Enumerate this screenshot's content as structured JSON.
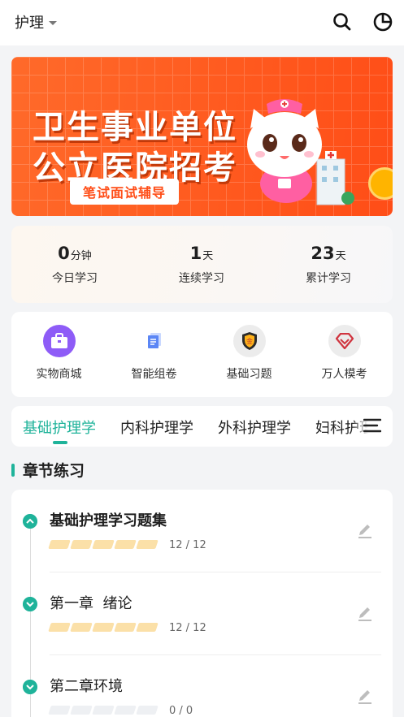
{
  "header": {
    "subject": "护理"
  },
  "banner": {
    "title_line1": "卫生事业单位",
    "title_line2": "公立医院招考",
    "tag": "笔试面试辅导"
  },
  "stats": [
    {
      "value": "0",
      "unit": "分钟",
      "label": "今日学习"
    },
    {
      "value": "1",
      "unit": "天",
      "label": "连续学习"
    },
    {
      "value": "23",
      "unit": "天",
      "label": "累计学习"
    }
  ],
  "quick_actions": [
    {
      "label": "实物商城",
      "icon": "shop-bag-icon"
    },
    {
      "label": "智能组卷",
      "icon": "paper-stack-icon"
    },
    {
      "label": "基础习题",
      "icon": "gold-shield-icon"
    },
    {
      "label": "万人模考",
      "icon": "diamond-icon"
    }
  ],
  "tabs": [
    "基础护理学",
    "内科护理学",
    "外科护理学",
    "妇科护理学"
  ],
  "section": {
    "title": "章节练习"
  },
  "chapters": [
    {
      "title": "基础护理学习题集",
      "count": "12 / 12",
      "progress": 1.0
    },
    {
      "title": "第一章  绪论",
      "count": "12 / 12",
      "progress": 1.0
    },
    {
      "title": "第二章环境",
      "count": "0 / 0",
      "progress": 0.0
    }
  ],
  "colors": {
    "accent": "#1fb39a",
    "banner": "#ff5a1f",
    "progress_fill": "#fbe0a8"
  }
}
